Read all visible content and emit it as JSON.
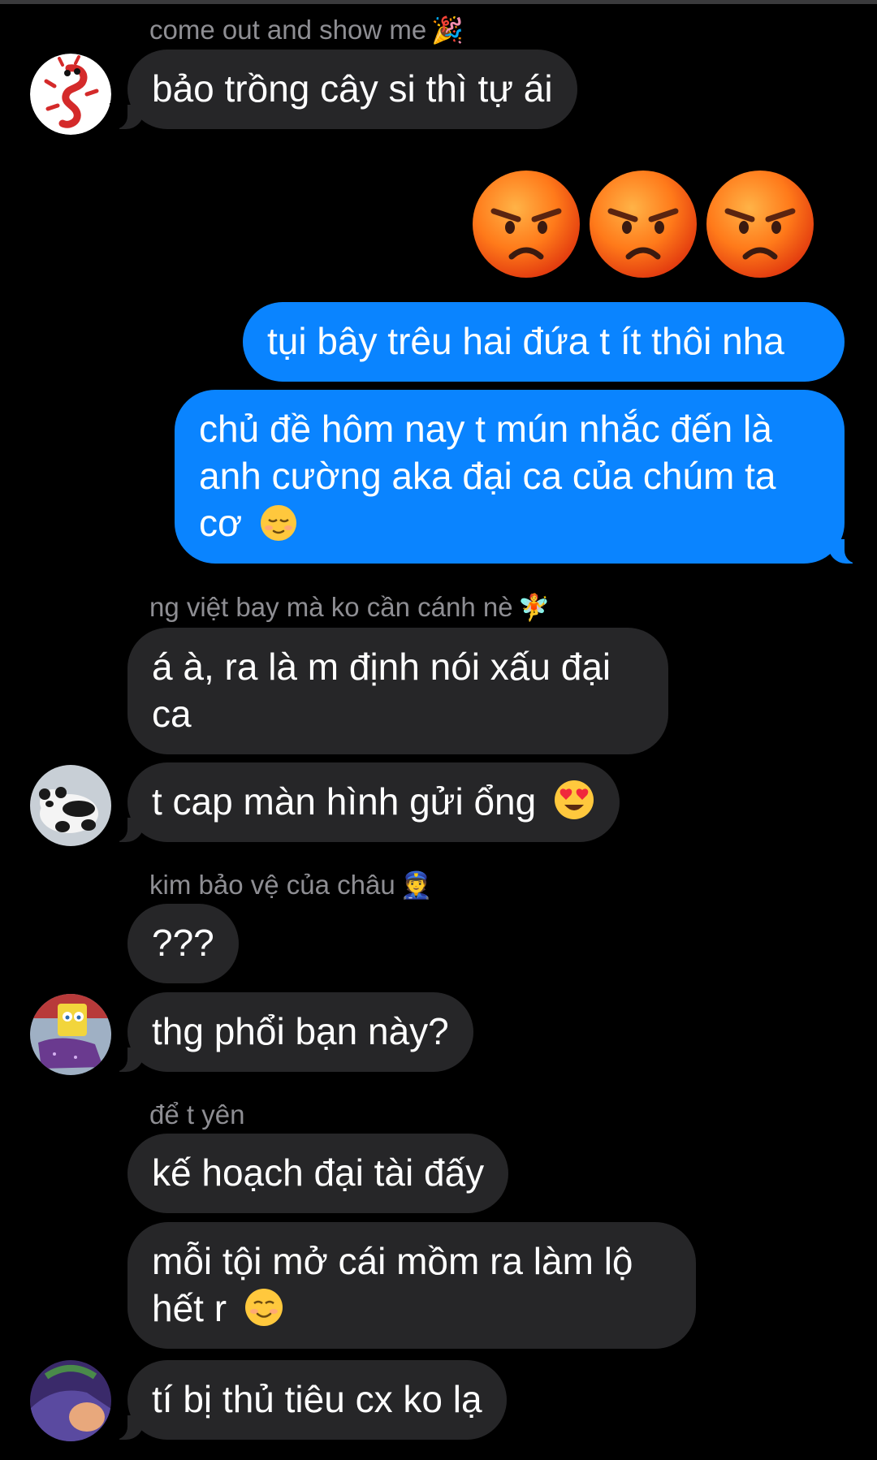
{
  "messages": [
    {
      "id": "m1",
      "sender": "come out and show me",
      "sender_emoji": "🎉",
      "text": "bảo trồng cây si thì tự ái"
    },
    {
      "id": "m2",
      "reaction": "😡😡😡"
    },
    {
      "id": "m3",
      "outgoing": true,
      "text": "tụi bây trêu hai đứa t ít thôi nha"
    },
    {
      "id": "m4",
      "outgoing": true,
      "text": "chủ đề hôm nay t mún nhắc đến là anh cường aka đại ca của chúm ta cơ",
      "emoji": "😌"
    },
    {
      "id": "m5",
      "sender": "ng việt bay mà ko cần cánh nè",
      "sender_emoji": "🧚",
      "text": "á à, ra là m định nói xấu đại ca"
    },
    {
      "id": "m6",
      "text": "t cap màn hình gửi ổng",
      "emoji": "😍"
    },
    {
      "id": "m7",
      "sender": "kim bảo vệ của châu",
      "sender_emoji": "👮",
      "text": "???"
    },
    {
      "id": "m8",
      "text": "thg phổi bạn này?"
    },
    {
      "id": "m9",
      "sender": "để t yên",
      "text": "kế hoạch đại tài đấy"
    },
    {
      "id": "m10",
      "text": "mỗi tội mở cái mồm ra làm lộ hết r",
      "emoji": "☺️"
    },
    {
      "id": "m11",
      "text": "tí bị thủ tiêu cx ko lạ"
    }
  ],
  "colors": {
    "background": "#000000",
    "incoming": "#262628",
    "outgoing": "#0a84ff",
    "sender": "#8e8e93"
  },
  "icons": [
    "dragon-avatar-icon",
    "panda-avatar-icon",
    "spongebob-avatar-icon",
    "cartoon-avatar-icon",
    "angry-face-icon",
    "relieved-face-icon",
    "heart-eyes-icon",
    "smiling-face-icon"
  ]
}
